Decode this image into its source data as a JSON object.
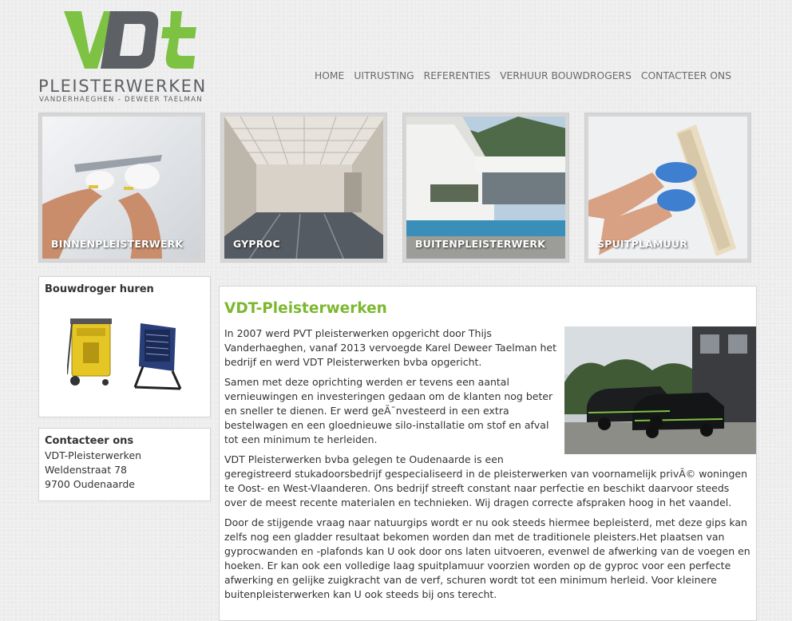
{
  "logo": {
    "mark": "VDT",
    "title": "PLEISTERWERKEN",
    "subtitle": "VANDERHAEGHEN - DEWEER TAELMAN",
    "green": "#7dc242",
    "gray": "#5d6166"
  },
  "nav": {
    "items": [
      "HOME",
      "UITRUSTING",
      "REFERENTIES",
      "VERHUUR BOUWDROGERS",
      "CONTACTEER ONS"
    ]
  },
  "tiles": [
    {
      "label": "BINNENPLEISTERWERK",
      "image": "plastering-interior-wall-photo"
    },
    {
      "label": "GYPROC",
      "image": "drywall-room-photo"
    },
    {
      "label": "BUITENPLEISTERWERK",
      "image": "modern-house-pool-photo"
    },
    {
      "label": "SPUITPLAMUUR",
      "image": "spray-plaster-hands-photo"
    }
  ],
  "sidebar": {
    "dryer": {
      "title": "Bouwdroger huren",
      "image": "construction-dryers-photo"
    },
    "contact": {
      "title": "Contacteer ons",
      "lines": [
        "VDT-Pleisterwerken",
        "Weldenstraat 78",
        "9700 Oudenaarde"
      ]
    }
  },
  "main": {
    "heading": "VDT-Pleisterwerken",
    "photo": "company-vans-photo",
    "paragraphs": [
      "In 2007 werd PVT pleisterwerken opgericht door Thijs Vanderhaeghen, vanaf 2013 vervoegde Karel Deweer Taelman het bedrijf en werd VDT Pleisterwerken bvba opgericht.",
      "Samen met deze oprichting werden er tevens een aantal vernieuwingen en investeringen gedaan om de klanten nog beter en sneller te dienen. Er werd geÃ¯nvesteerd in een extra bestelwagen en een gloednieuwe silo-installatie om stof en afval tot een minimum te herleiden.",
      "VDT Pleisterwerken bvba gelegen te Oudenaarde is een geregistreerd stukadoorsbedrijf gespecialiseerd in de pleisterwerken van voornamelijk privÃ© woningen te Oost- en West-Vlaanderen. Ons bedrijf streeft constant naar perfectie en beschikt daarvoor steeds over de meest recente materialen en technieken. Wij dragen correcte afspraken hoog in het vaandel.",
      "Door de stijgende vraag naar natuurgips wordt er nu ook steeds hiermee bepleisterd, met deze gips kan zelfs nog een gladder resultaat bekomen worden dan met de traditionele pleisters.Het plaatsen van gyprocwanden en -plafonds kan U ook door ons laten uitvoeren, evenwel de afwerking van de voegen en hoeken. Er kan ook een volledige laag spuitplamuur voorzien worden op de gyproc voor een perfecte afwerking en gelijke zuigkracht van de verf, schuren wordt tot een minimum herleid. Voor kleinere buitenpleisterwerken kan U ook steeds bij ons terecht."
    ]
  }
}
